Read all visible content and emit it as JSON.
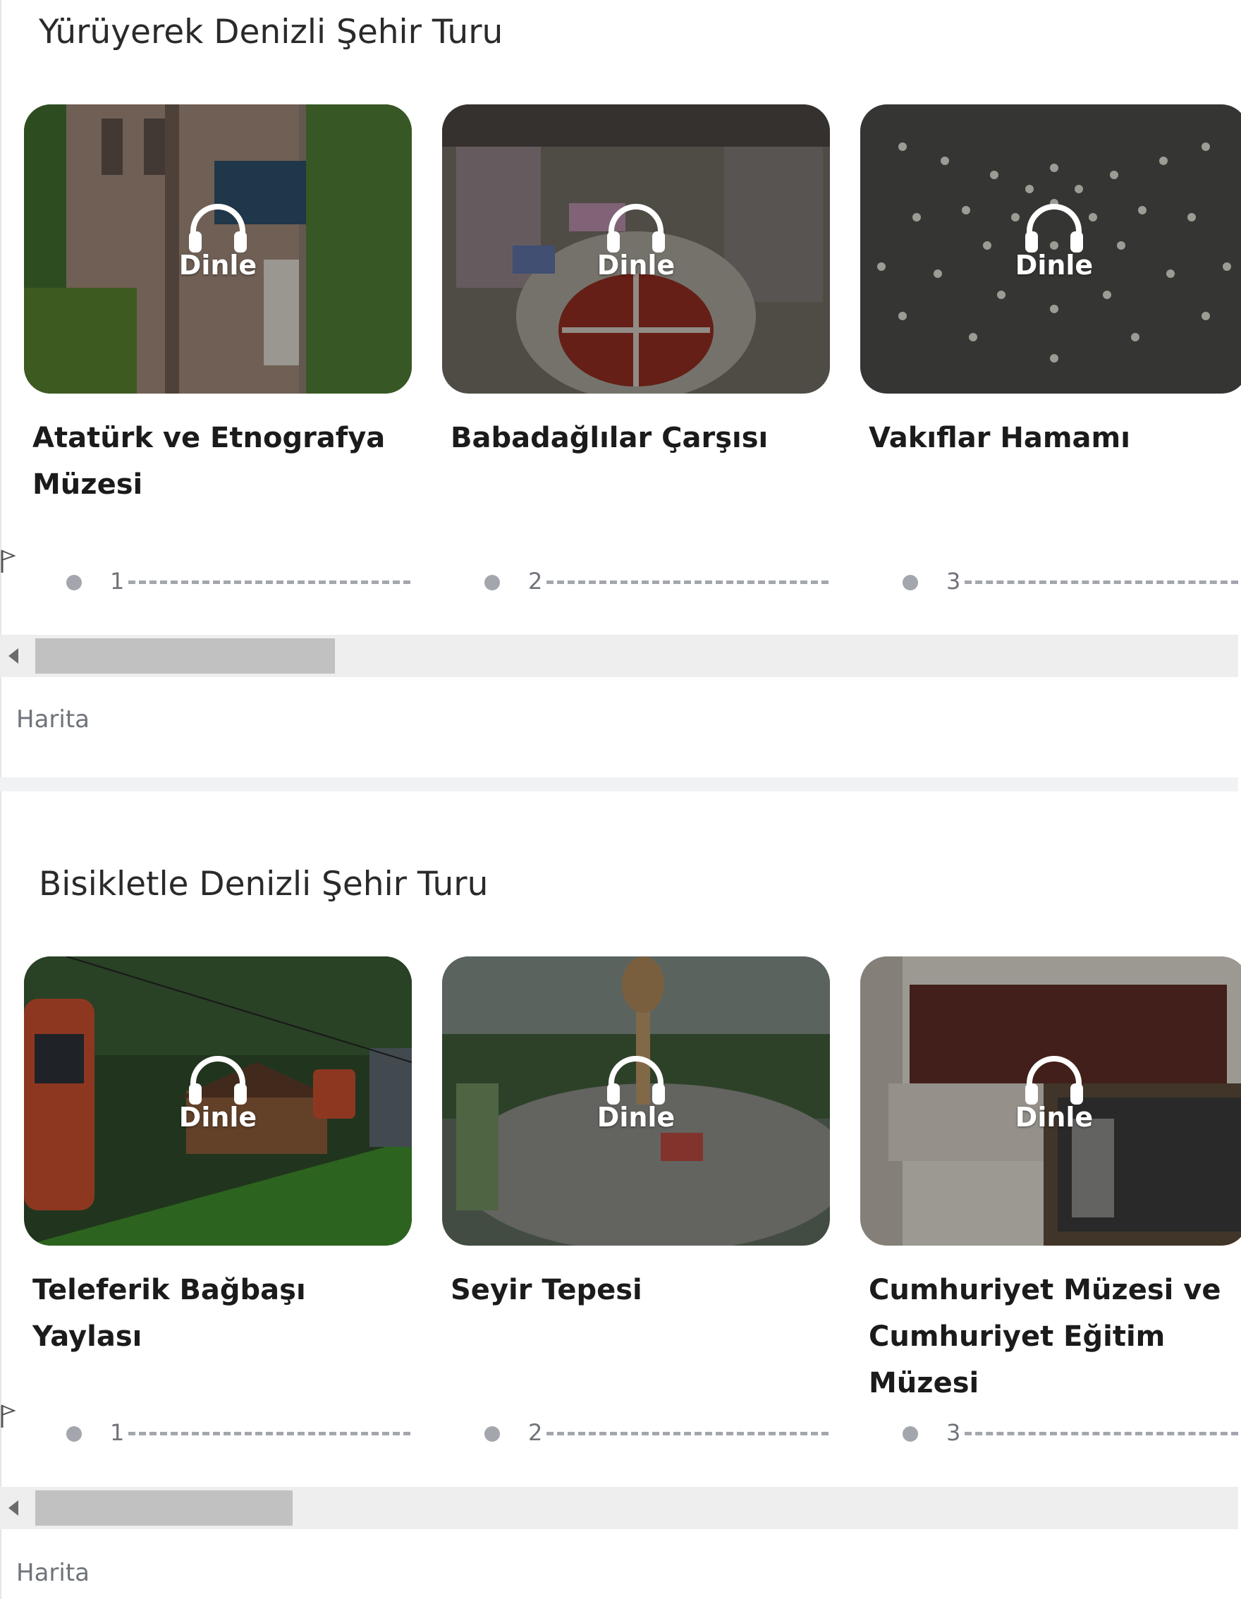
{
  "tours": [
    {
      "title": "Yürüyerek Denizli Şehir Turu",
      "listen_label": "Dinle",
      "map_label": "Harita",
      "stops": [
        {
          "number": "1",
          "title": "Atatürk ve Etnografya Müzesi",
          "listen": "Dinle"
        },
        {
          "number": "2",
          "title": "Babadağlılar Çarşısı",
          "listen": "Dinle"
        },
        {
          "number": "3",
          "title": "Vakıflar Hamamı",
          "listen": "Dinle"
        }
      ]
    },
    {
      "title": "Bisikletle Denizli Şehir Turu",
      "listen_label": "Dinle",
      "map_label": "Harita",
      "stops": [
        {
          "number": "1",
          "title": "Teleferik Bağbaşı Yaylası",
          "listen": "Dinle"
        },
        {
          "number": "2",
          "title": "Seyir Tepesi",
          "listen": "Dinle"
        },
        {
          "number": "3",
          "title": "Cumhuriyet Müzesi ve Cumhuriyet Eğitim Müzesi",
          "listen": "Dinle"
        }
      ]
    }
  ],
  "icons": {
    "listen": "headphones-icon",
    "start": "flag-icon",
    "scroll_left": "scroll-left-arrow-icon"
  },
  "colors": {
    "step_dot": "#a3a6ad",
    "scrollbar_track": "#eeeeee",
    "scrollbar_thumb": "#c1c1c1",
    "muted_text": "#6f737a"
  }
}
